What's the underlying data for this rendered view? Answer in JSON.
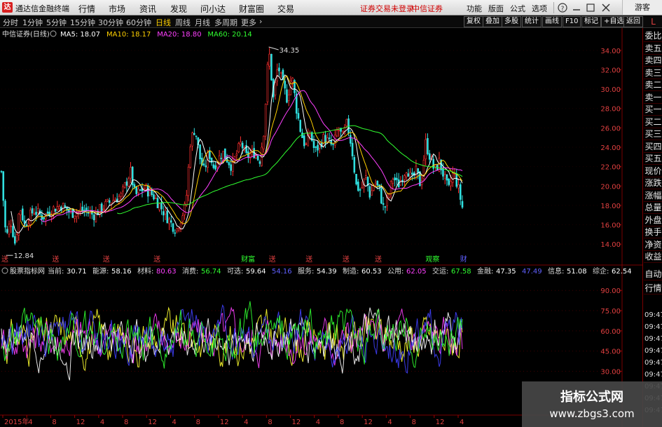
{
  "app": {
    "title": "通达信金融终端",
    "logo": "达"
  },
  "menu": [
    "行情",
    "市场",
    "资讯",
    "发现",
    "问小达",
    "财富圈",
    "交易"
  ],
  "notice": [
    "证券交易未登录",
    "中信证券"
  ],
  "top_tools": [
    "功能",
    "版面",
    "公式",
    "选项"
  ],
  "guest_label": "游客",
  "periods": [
    {
      "label": "分时",
      "active": false
    },
    {
      "label": "1分钟",
      "active": false
    },
    {
      "label": "5分钟",
      "active": false
    },
    {
      "label": "15分钟",
      "active": false
    },
    {
      "label": "30分钟",
      "active": false
    },
    {
      "label": "60分钟",
      "active": false
    },
    {
      "label": "日线",
      "active": true
    },
    {
      "label": "周线",
      "active": false
    },
    {
      "label": "月线",
      "active": false
    },
    {
      "label": "多周期",
      "active": false
    },
    {
      "label": "更多",
      "active": false
    }
  ],
  "toolbar_right": [
    "复权",
    "叠加",
    "多股",
    "统计",
    "画线",
    "F10",
    "标记",
    "+自选",
    "返回"
  ],
  "stock_header": {
    "name": "中信证券(日线)",
    "ma": [
      {
        "label": "MA5: 18.07",
        "color": "#ffffff"
      },
      {
        "label": "MA10: 18.17",
        "color": "#ffd000"
      },
      {
        "label": "MA20: 18.80",
        "color": "#ff40ff"
      },
      {
        "label": "MA60: 20.14",
        "color": "#30ff30"
      }
    ]
  },
  "indicator_header": {
    "name": "股票指标网",
    "items": [
      {
        "label": "当前:",
        "value": "30.71",
        "color": "#ffffff"
      },
      {
        "label": "能源:",
        "value": "58.16",
        "color": "#ffffff"
      },
      {
        "label": "材料:",
        "value": "80.63",
        "color": "#ff40ff"
      },
      {
        "label": "消费:",
        "value": "56.74",
        "color": "#30ff30"
      },
      {
        "label": "可选:",
        "value": "59.64",
        "color": "#ffffff"
      },
      {
        "label": "",
        "value": "54.16",
        "color": "#6060ff"
      },
      {
        "label": "服务:",
        "value": "54.39",
        "color": "#ffffff"
      },
      {
        "label": "制造:",
        "value": "60.53",
        "color": "#ffffff"
      },
      {
        "label": "公用:",
        "value": "62.05",
        "color": "#ff40ff"
      },
      {
        "label": "交运:",
        "value": "67.58",
        "color": "#30ff30"
      },
      {
        "label": "金融:",
        "value": "47.35",
        "color": "#ffffff"
      },
      {
        "label": "",
        "value": "47.49",
        "color": "#6060ff"
      },
      {
        "label": "信息:",
        "value": "51.08",
        "color": "#ffffff"
      },
      {
        "label": "综企:",
        "value": "62.54",
        "color": "#ffffff"
      }
    ]
  },
  "sidebar": {
    "top": "L",
    "items": [
      "委比",
      "卖五",
      "卖四",
      "卖三",
      "卖二",
      "卖一",
      "买一",
      "买二",
      "买三",
      "买四",
      "买五",
      "现价",
      "涨跌",
      "涨幅",
      "总量",
      "外盘",
      "换手",
      "净资",
      "收益",
      "自动",
      "行情"
    ],
    "times": [
      "09:47",
      "09:47",
      "09:47",
      "09:47",
      "09:47",
      "09:47",
      "09:47",
      "09:47",
      "09:47"
    ]
  },
  "watermark": {
    "title": "指标公式网",
    "url": "www.zbgs3.com"
  },
  "chart_data": [
    {
      "type": "candlestick",
      "title": "中信证券(日线)",
      "y_ticks": [
        "34.00",
        "32.00",
        "30.00",
        "28.00",
        "26.00",
        "24.00",
        "22.00",
        "20.00",
        "18.00",
        "16.00",
        "14.00"
      ],
      "ylim": [
        13.0,
        35.0
      ],
      "annotations": [
        {
          "label": "34.35",
          "kind": "high"
        },
        {
          "label": "12.84",
          "kind": "low"
        }
      ],
      "event_labels": [
        {
          "label": "送",
          "t": 0.0
        },
        {
          "label": "送",
          "t": 0.11
        },
        {
          "label": "送",
          "t": 0.22
        },
        {
          "label": "送",
          "t": 0.33
        },
        {
          "label": "财富",
          "t": 0.52
        },
        {
          "label": "送",
          "t": 0.58
        },
        {
          "label": "送",
          "t": 0.66
        },
        {
          "label": "送",
          "t": 0.74
        },
        {
          "label": "送",
          "t": 0.81
        },
        {
          "label": "观察",
          "t": 0.92
        },
        {
          "label": "财",
          "t": 0.995
        }
      ],
      "close_path": [
        [
          0.0,
          21.5
        ],
        [
          0.01,
          14.5
        ],
        [
          0.02,
          16.5
        ],
        [
          0.03,
          14.0
        ],
        [
          0.04,
          18.0
        ],
        [
          0.05,
          16.0
        ],
        [
          0.07,
          17.5
        ],
        [
          0.09,
          16.8
        ],
        [
          0.11,
          17.6
        ],
        [
          0.13,
          18.0
        ],
        [
          0.15,
          17.2
        ],
        [
          0.18,
          17.5
        ],
        [
          0.2,
          17.0
        ],
        [
          0.22,
          17.8
        ],
        [
          0.24,
          18.5
        ],
        [
          0.26,
          19.0
        ],
        [
          0.28,
          21.5
        ],
        [
          0.29,
          19.0
        ],
        [
          0.31,
          19.8
        ],
        [
          0.33,
          19.0
        ],
        [
          0.35,
          17.5
        ],
        [
          0.37,
          16.0
        ],
        [
          0.38,
          15.5
        ],
        [
          0.4,
          18.0
        ],
        [
          0.41,
          24.5
        ],
        [
          0.42,
          26.0
        ],
        [
          0.43,
          23.0
        ],
        [
          0.44,
          21.5
        ],
        [
          0.45,
          23.5
        ],
        [
          0.46,
          22.0
        ],
        [
          0.48,
          23.5
        ],
        [
          0.5,
          22.0
        ],
        [
          0.52,
          24.5
        ],
        [
          0.53,
          23.0
        ],
        [
          0.55,
          23.5
        ],
        [
          0.56,
          22.5
        ],
        [
          0.57,
          26.0
        ],
        [
          0.58,
          34.3
        ],
        [
          0.59,
          29.0
        ],
        [
          0.6,
          32.5
        ],
        [
          0.61,
          30.5
        ],
        [
          0.62,
          29.0
        ],
        [
          0.63,
          31.5
        ],
        [
          0.64,
          28.0
        ],
        [
          0.65,
          25.5
        ],
        [
          0.66,
          24.0
        ],
        [
          0.67,
          25.5
        ],
        [
          0.68,
          23.5
        ],
        [
          0.7,
          25.0
        ],
        [
          0.72,
          24.0
        ],
        [
          0.73,
          26.0
        ],
        [
          0.74,
          25.0
        ],
        [
          0.75,
          26.5
        ],
        [
          0.76,
          24.0
        ],
        [
          0.77,
          20.0
        ],
        [
          0.78,
          19.5
        ],
        [
          0.79,
          21.0
        ],
        [
          0.8,
          19.0
        ],
        [
          0.81,
          20.5
        ],
        [
          0.82,
          19.5
        ],
        [
          0.83,
          17.5
        ],
        [
          0.84,
          19.0
        ],
        [
          0.85,
          21.0
        ],
        [
          0.86,
          20.0
        ],
        [
          0.87,
          21.0
        ],
        [
          0.88,
          22.0
        ],
        [
          0.89,
          20.5
        ],
        [
          0.9,
          21.5
        ],
        [
          0.91,
          20.0
        ],
        [
          0.92,
          24.5
        ],
        [
          0.93,
          23.0
        ],
        [
          0.94,
          21.5
        ],
        [
          0.95,
          22.5
        ],
        [
          0.96,
          21.0
        ],
        [
          0.97,
          19.5
        ],
        [
          0.98,
          21.5
        ],
        [
          0.99,
          20.0
        ],
        [
          1.0,
          17.8
        ]
      ]
    },
    {
      "type": "line",
      "title": "股票指标网",
      "y_ticks": [
        "90.00",
        "75.00",
        "60.00",
        "45.00",
        "30.00"
      ],
      "ylim": [
        10,
        100
      ],
      "series_colors": [
        "#ffff30",
        "#ff40ff",
        "#ffffff",
        "#4040ff",
        "#30ff30"
      ]
    }
  ],
  "x_axis": {
    "labels": [
      "2015年",
      "4",
      "8",
      "12",
      "4",
      "8",
      "12",
      "4",
      "8",
      "12",
      "4",
      "8",
      "12",
      "4",
      "8",
      "12",
      "4",
      "8",
      "12",
      "4"
    ]
  }
}
